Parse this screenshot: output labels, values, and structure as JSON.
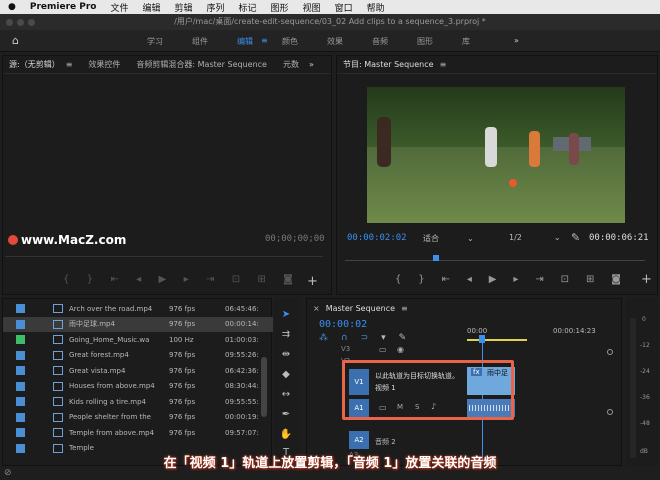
{
  "menubar": {
    "apple": "",
    "app": "Premiere Pro",
    "items": [
      "文件",
      "编辑",
      "剪辑",
      "序列",
      "标记",
      "图形",
      "视图",
      "窗口",
      "帮助"
    ]
  },
  "titlebar": {
    "path": "/用户/mac/桌面/create-edit-sequence/03_02 Add clips to a sequence_3.prproj *"
  },
  "workspace": {
    "tabs": [
      "学习",
      "组件",
      "编辑",
      "颜色",
      "效果",
      "音频",
      "图形",
      "库"
    ],
    "active": "编辑",
    "more": "»",
    "menu": "≡"
  },
  "source_panel": {
    "tabs": [
      "源:（无剪辑）",
      "效果控件",
      "音频剪辑混合器: Master Sequence",
      "元数"
    ],
    "timecode": "00;00;00;00",
    "menu": "≡",
    "more": "»"
  },
  "program_panel": {
    "title": "节目: Master Sequence",
    "menu": "≡",
    "timecode": "00:00:02:02",
    "fit": "适合",
    "ratio": "1/2",
    "duration": "00:00:06:21"
  },
  "watermark": {
    "text": "www.MacZ.com"
  },
  "project_list": {
    "rows": [
      {
        "name": "Arch over the road.mp4",
        "fps": "976 fps",
        "tc": "06:45:46:",
        "color": "blue",
        "selected": false
      },
      {
        "name": "雨中足球.mp4",
        "fps": "976 fps",
        "tc": "00:00:14:",
        "color": "blue",
        "selected": true
      },
      {
        "name": "Going_Home_Music.wa",
        "fps": "100 Hz",
        "tc": "01:00:03:",
        "color": "green",
        "selected": false
      },
      {
        "name": "Great forest.mp4",
        "fps": "976 fps",
        "tc": "09:55:26:",
        "color": "blue",
        "selected": false
      },
      {
        "name": "Great vista.mp4",
        "fps": "976 fps",
        "tc": "06:42:36:",
        "color": "blue",
        "selected": false
      },
      {
        "name": "Houses from above.mp4",
        "fps": "976 fps",
        "tc": "08:30:44:",
        "color": "blue",
        "selected": false
      },
      {
        "name": "Kids rolling a tire.mp4",
        "fps": "976 fps",
        "tc": "09:55:55:",
        "color": "blue",
        "selected": false
      },
      {
        "name": "People shelter from the",
        "fps": "976 fps",
        "tc": "00:00:19:",
        "color": "blue",
        "selected": false
      },
      {
        "name": "Temple from above.mp4",
        "fps": "976 fps",
        "tc": "09:57:07:",
        "color": "blue",
        "selected": false
      },
      {
        "name": "Temple",
        "fps": "",
        "tc": "",
        "color": "blue",
        "selected": false
      }
    ]
  },
  "timeline": {
    "title": "Master Sequence",
    "menu": "≡",
    "close": "×",
    "timecode": "00:00:02",
    "ruler": [
      "00:00",
      "00:00:14:23"
    ],
    "tracks": [
      {
        "label": "V3"
      },
      {
        "label": "V2"
      },
      {
        "label": "V1"
      },
      {
        "label": "A1"
      },
      {
        "label": "A2"
      },
      {
        "label": "A3"
      }
    ],
    "clip_label": "雨中足",
    "tooltip": "以此轨道为目标切换轨道。",
    "track_name": "视频 1",
    "audio2_name": "音频 2",
    "track_buttons": [
      "M",
      "S"
    ],
    "meter_scale": [
      "0",
      "-12",
      "-24",
      "-36",
      "-48",
      "dB"
    ]
  },
  "caption": {
    "text": "在「视频 1」轨道上放置剪辑，「音频 1」放置关联的音频"
  },
  "colors": {
    "accent": "#3a8ff0",
    "highlight": "#e8654a",
    "clip": "#6fa8dc"
  }
}
